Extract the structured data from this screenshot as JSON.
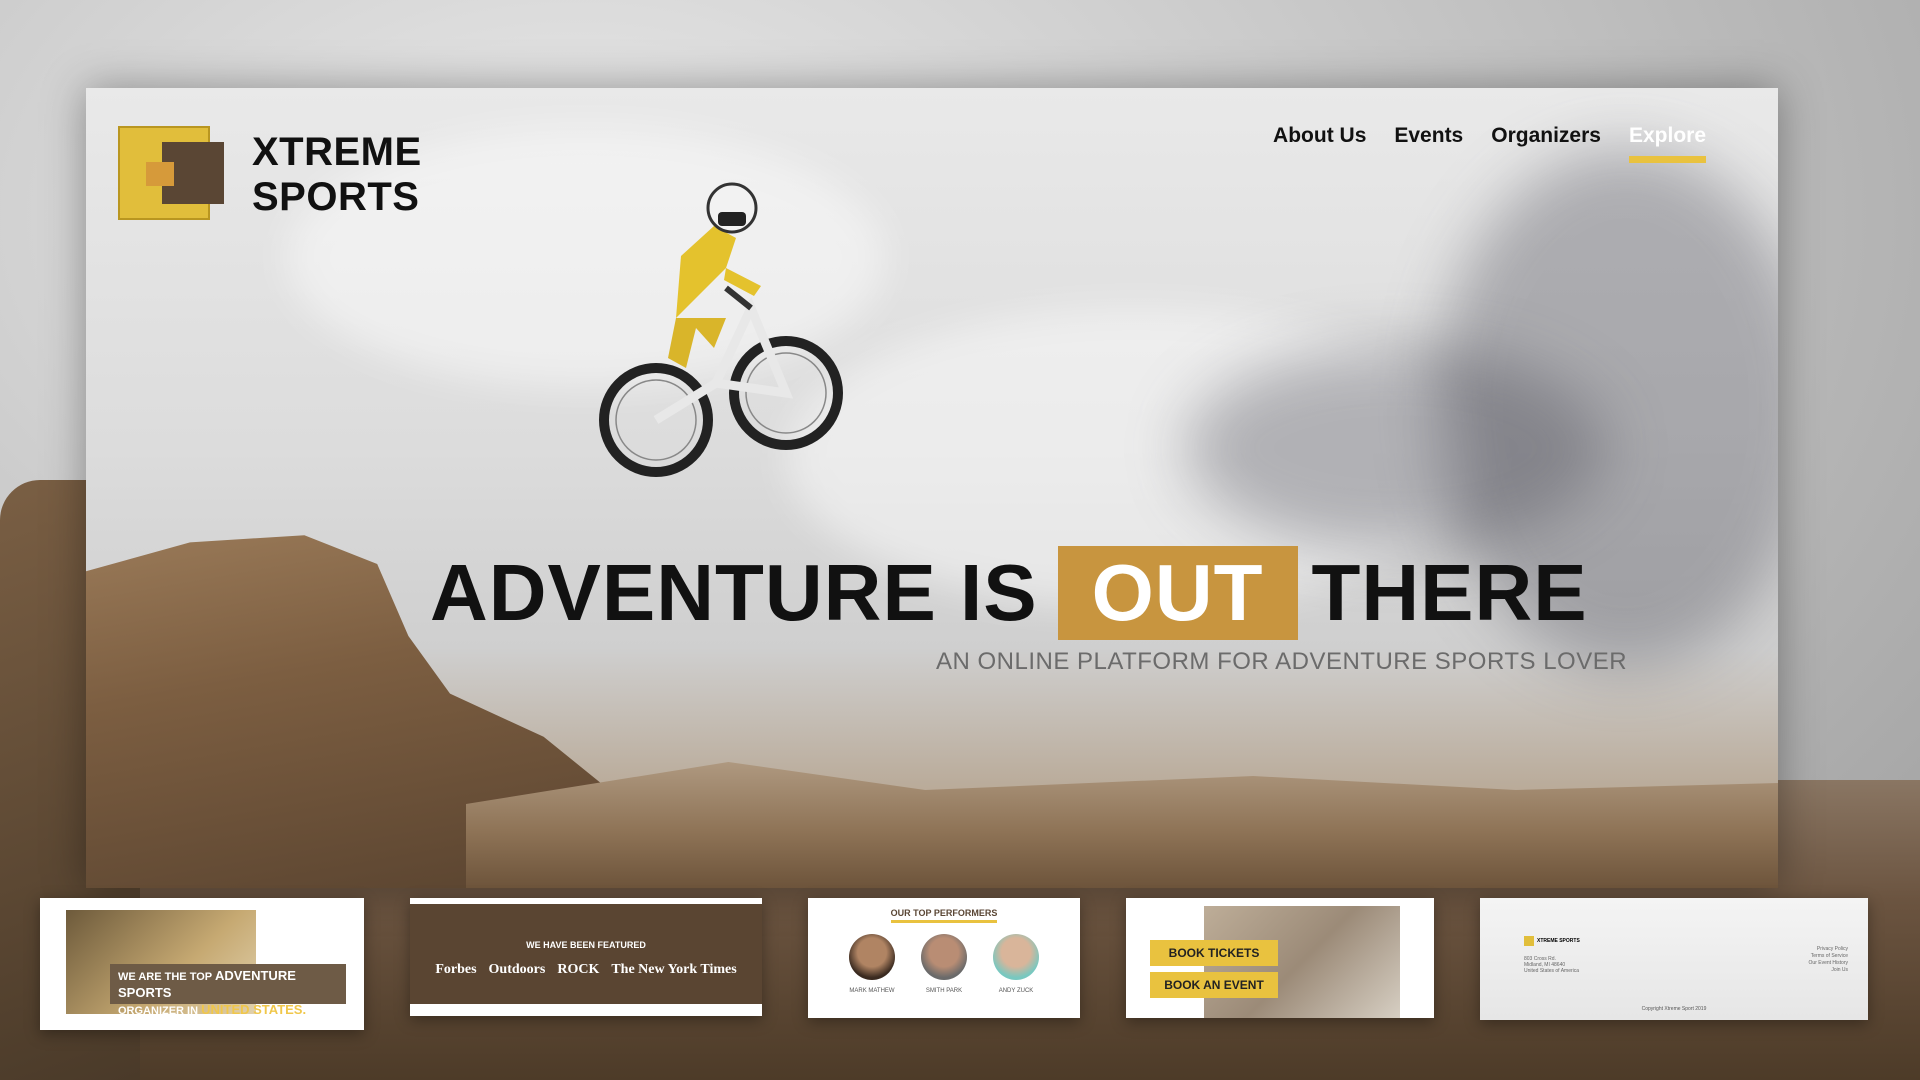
{
  "brand": {
    "line1": "XTREME",
    "line2": "SPORTS"
  },
  "nav": [
    {
      "label": "About Us",
      "active": false
    },
    {
      "label": "Events",
      "active": false
    },
    {
      "label": "Organizers",
      "active": false
    },
    {
      "label": "Explore",
      "active": true
    }
  ],
  "hero": {
    "headline_before": "ADVENTURE IS",
    "headline_highlight": "OUT",
    "headline_after": "THERE",
    "subheadline": "AN ONLINE PLATFORM FOR ADVENTURE SPORTS LOVER"
  },
  "thumbnails": {
    "about": {
      "prefix": "WE ARE THE TOP",
      "strong": "ADVENTURE SPORTS",
      "mid": "ORGANIZER IN",
      "place": "UNITED STATES."
    },
    "featured": {
      "title": "WE HAVE BEEN FEATURED",
      "logos": [
        "Forbes",
        "Outdoors",
        "ROCK",
        "The New York Times"
      ]
    },
    "performers": {
      "title": "OUR TOP PERFORMERS",
      "people": [
        "MARK MATHEW",
        "SMITH PARK",
        "ANDY ZUCK"
      ]
    },
    "booking": {
      "tickets": "BOOK TICKETS",
      "event": "BOOK AN EVENT"
    },
    "footer": {
      "brand": "XTREME SPORTS",
      "address": [
        "803 Cross Rd.",
        "Midland, MI 48640",
        "United States of America"
      ],
      "links": [
        "Privacy Policy",
        "Terms of Service",
        "Our Event History",
        "Join Us"
      ],
      "copyright": "Copyright Xtreme Sport 2019"
    }
  },
  "colors": {
    "accent_yellow": "#e9c23f",
    "accent_gold": "#c8953f",
    "brown": "#5a4634"
  }
}
